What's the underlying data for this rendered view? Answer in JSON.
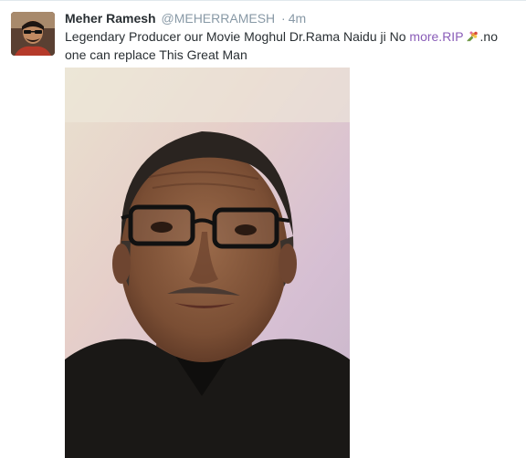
{
  "tweet": {
    "author": {
      "fullname": "Meher Ramesh",
      "username": "@MEHERRAMESH",
      "avatar_icon": "profile-photo"
    },
    "separator": "·",
    "timestamp": "4m",
    "text_part1": "Legendary Producer our Movie Moghul Dr.Rama Naidu ji No ",
    "link_text": "more.RIP",
    "emoji_icon": "bouquet-icon",
    "text_part2": ".no one can replace This Great Man",
    "media": {
      "type": "photo",
      "subject": "portrait-of-elderly-man-with-glasses"
    }
  },
  "colors": {
    "name": "#292f33",
    "meta": "#8899a6",
    "link": "#8a5db8",
    "border": "#e1e8ed"
  }
}
